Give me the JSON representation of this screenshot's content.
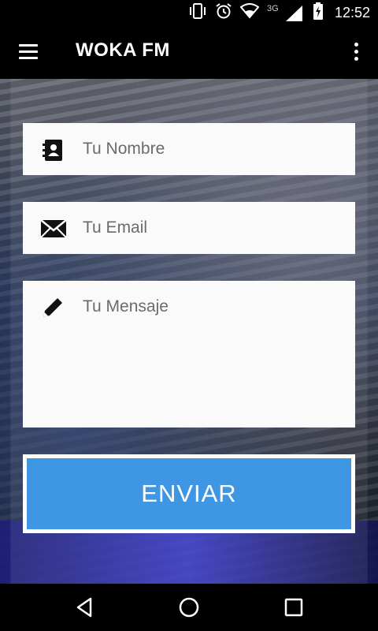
{
  "status_bar": {
    "time": "12:52",
    "network_label": "3G",
    "icons": [
      "vibrate-icon",
      "alarm-icon",
      "wifi-icon",
      "signal-icon",
      "battery-icon"
    ]
  },
  "app_bar": {
    "title": "WOKA FM",
    "menu_icon": "hamburger-menu-icon",
    "overflow_icon": "overflow-menu-icon"
  },
  "form": {
    "name": {
      "placeholder": "Tu Nombre",
      "icon": "contact-book-icon",
      "value": ""
    },
    "email": {
      "placeholder": "Tu Email",
      "icon": "envelope-icon",
      "value": ""
    },
    "message": {
      "placeholder": "Tu Mensaje",
      "icon": "pencil-icon",
      "value": ""
    },
    "submit_label": "ENVIAR"
  },
  "colors": {
    "accent": "#3f97e3",
    "app_bar": "#000000",
    "field_bg": "#fafafa"
  },
  "nav_bar": {
    "icons": [
      "back-icon",
      "home-icon",
      "recents-icon"
    ]
  }
}
